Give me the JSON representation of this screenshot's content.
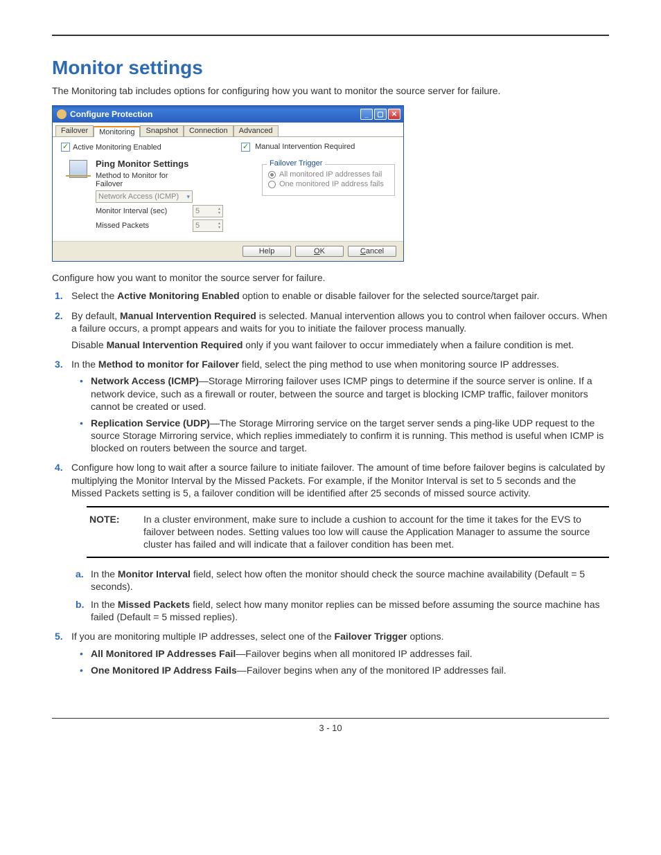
{
  "heading": "Monitor settings",
  "intro": "The Monitoring tab includes options for configuring how you want to monitor the source server for failure.",
  "dialog": {
    "title": "Configure Protection",
    "tabs": [
      "Failover",
      "Monitoring",
      "Snapshot",
      "Connection",
      "Advanced"
    ],
    "active_tab": 1,
    "active_monitoring_label": "Active Monitoring Enabled",
    "manual_intervention_label": "Manual Intervention Required",
    "ping_header": "Ping Monitor Settings",
    "method_label": "Method to Monitor for Failover",
    "method_value": "Network Access (ICMP)",
    "interval_label": "Monitor Interval (sec)",
    "interval_value": "5",
    "missed_label": "Missed Packets",
    "missed_value": "5",
    "trigger_legend": "Failover Trigger",
    "trigger_all": "All monitored IP addresses fail",
    "trigger_one": "One monitored IP address fails",
    "buttons": {
      "help": "Help",
      "ok": "OK",
      "cancel": "Cancel"
    }
  },
  "configure_line": "Configure how you want to monitor the source server for failure.",
  "step1": {
    "pre": "Select the ",
    "bold": "Active Monitoring Enabled",
    "post": " option to enable or disable failover for the selected source/target pair."
  },
  "step2": {
    "p1_pre": "By default, ",
    "p1_bold": "Manual Intervention Required",
    "p1_post": " is selected. Manual intervention allows you to control when failover occurs. When a failure occurs, a prompt appears and waits for you to initiate the failover process manually.",
    "p2_pre": "Disable ",
    "p2_bold": "Manual Intervention Required",
    "p2_post": " only if you want failover to occur immediately when a failure condition is met."
  },
  "step3": {
    "pre": "In the ",
    "bold": "Method to monitor for Failover",
    "post": " field, select the ping method to use when monitoring source IP addresses.",
    "bullet1_bold": "Network Access (ICMP)",
    "bullet1_text": "—Storage Mirroring failover uses ICMP pings to determine if the source server is online. If a network device, such as a firewall or router, between the source and target is blocking ICMP traffic, failover monitors cannot be created or used.",
    "bullet2_bold": "Replication Service (UDP)",
    "bullet2_text": "—The Storage Mirroring service on the target server sends a ping-like UDP request to the source Storage Mirroring service, which replies immediately to confirm it is running. This method is useful when ICMP is blocked on routers between the source and target."
  },
  "step4": {
    "text": "Configure how long to wait after a source failure to initiate failover. The amount of time before failover begins is calculated by multiplying the Monitor Interval by the Missed Packets. For example, if the Monitor Interval is set to 5 seconds and the Missed Packets setting is 5, a failover condition will be identified after 25 seconds of missed source activity.",
    "note_label": "NOTE:",
    "note_text": "In a cluster environment, make sure to include a cushion to account for the time it takes for the EVS to failover between nodes. Setting values too low will cause the Application Manager to assume the source cluster has failed and will indicate that a failover condition has been met.",
    "a_pre": "In the ",
    "a_bold": "Monitor Interval",
    "a_post": " field, select how often the monitor should check the source machine availability (Default = 5 seconds).",
    "b_pre": "In the ",
    "b_bold": "Missed Packets",
    "b_post": " field, select how many monitor replies can be missed before assuming the source machine has failed (Default = 5 missed replies)."
  },
  "step5": {
    "pre": "If you are monitoring multiple IP addresses, select one of the ",
    "bold": "Failover Trigger",
    "post": " options.",
    "bullet1_bold": "All Monitored IP Addresses Fail",
    "bullet1_text": "—Failover begins when all monitored IP addresses fail.",
    "bullet2_bold": "One Monitored IP Address Fails",
    "bullet2_text": "—Failover begins when any of the monitored IP addresses fail."
  },
  "page_number": "3 - 10"
}
